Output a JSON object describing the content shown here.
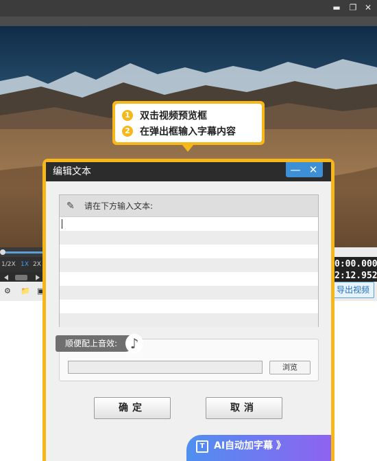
{
  "window": {
    "minimize_glyph": "▬",
    "maximize_glyph": "❐",
    "close_glyph": "✕"
  },
  "callout": {
    "steps": [
      {
        "num": "1",
        "text": "双击视频预览框"
      },
      {
        "num": "2",
        "text": "在弹出框输入字幕内容"
      }
    ]
  },
  "player": {
    "speeds": [
      "1/2X",
      "1X",
      "2X"
    ],
    "active_speed": "1X",
    "current_time": "0:00.000",
    "total_time": "2:12.952",
    "export_label": "导出视频"
  },
  "dialog": {
    "title": "编辑文本",
    "minimize_glyph": "—",
    "close_glyph": "✕",
    "prompt": "请在下方输入文本:",
    "text_value": "",
    "sound_label": "顺便配上音效:",
    "sound_path": "",
    "browse_label": "浏览",
    "ok_label": "确定",
    "cancel_label": "取消",
    "ai_label": "AI自动加字幕 》"
  },
  "colors": {
    "accent": "#f6b71b",
    "dialog_title_bg": "#2c2c2c",
    "title_btn_bg": "#3d8fd6",
    "ai_gradient_start": "#4f8ff0",
    "ai_gradient_end": "#8e63f0"
  }
}
